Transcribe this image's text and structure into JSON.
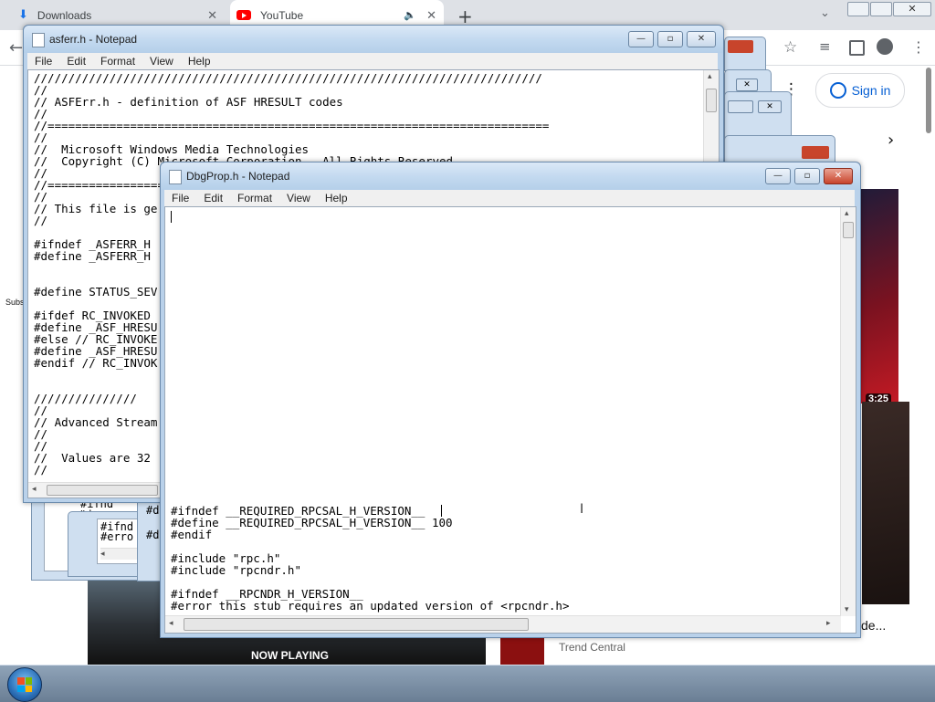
{
  "browser": {
    "tabs": [
      {
        "label": "Downloads",
        "icon": "download-icon"
      },
      {
        "label": "YouTube",
        "icon": "youtube-icon",
        "audio": "speaker-icon"
      }
    ],
    "new_tab": "+",
    "window_controls": {
      "minimize": "—",
      "restore": "❐",
      "close": "✕"
    }
  },
  "youtube": {
    "signin_label": "Sign in",
    "now_playing": "NOW PLAYING",
    "channel": "Trend Central",
    "title_fragment": "de...",
    "duration": "3:25",
    "sidebar_fragments": [
      "Subs"
    ]
  },
  "asferr_window": {
    "title": "asferr.h - Notepad",
    "menu": [
      "File",
      "Edit",
      "Format",
      "View",
      "Help"
    ],
    "lines": [
      "//////////////////////////////////////////////////////////////////////////",
      "//",
      "// ASFErr.h - definition of ASF HRESULT codes",
      "//",
      "//=========================================================================",
      "//",
      "//  Microsoft Windows Media Technologies",
      "//  Copyright (C) Microsoft Corporation.  All Rights Reserved.",
      "//",
      "//=========================================================================",
      "//",
      "// This file is ge",
      "//",
      "",
      "#ifndef _ASFERR_H",
      "#define _ASFERR_H",
      "",
      "",
      "#define STATUS_SEV",
      "",
      "#ifdef RC_INVOKED",
      "#define _ASF_HRESU",
      "#else // RC_INVOKE",
      "#define _ASF_HRESU",
      "#endif // RC_INVOK",
      "",
      "",
      "///////////////",
      "//",
      "// Advanced Stream",
      "//",
      "//",
      "//  Values are 32",
      "//"
    ]
  },
  "dbgprop_window": {
    "title": "DbgProp.h - Notepad",
    "menu": [
      "File",
      "Edit",
      "Format",
      "View",
      "Help"
    ],
    "lines": [
      "#ifndef __REQUIRED_RPCSAL_H_VERSION__",
      "#define __REQUIRED_RPCSAL_H_VERSION__ 100",
      "#endif",
      "",
      "#include \"rpc.h\"",
      "#include \"rpcndr.h\"",
      "",
      "#ifndef __RPCNDR_H_VERSION__",
      "#error this stub requires an updated version of <rpcndr.h>"
    ]
  },
  "background_fragments": [
    "#ifnd",
    "#d",
    "#ifnd",
    "#erro",
    "#d",
    "#d"
  ],
  "colors": {
    "title_bar": "#c4daf0",
    "close_button": "#c8442b",
    "taskbar": "#6a7e94",
    "youtube_red": "#ff0000",
    "link_blue": "#065fd4"
  }
}
